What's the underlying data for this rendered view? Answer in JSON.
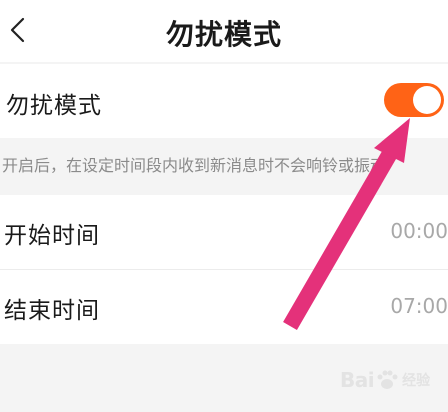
{
  "header": {
    "title": "勿扰模式",
    "back_icon": "chevron-left-icon"
  },
  "dnd": {
    "label": "勿扰模式",
    "toggle_on": true,
    "toggle_color": "#ff6316"
  },
  "hint": {
    "text": "开启后，在设定时间段内收到新消息时不会响铃或振动"
  },
  "schedule": {
    "start_label": "开始时间",
    "start_value": "00:00",
    "end_label": "结束时间",
    "end_value": "07:00"
  },
  "overlay": {
    "arrow_color": "#e4317a",
    "arrow_icon": "pointer-arrow-icon"
  },
  "watermark": {
    "brand_left": "Bai",
    "brand_right": "经验",
    "logo_icon": "paw-icon"
  }
}
